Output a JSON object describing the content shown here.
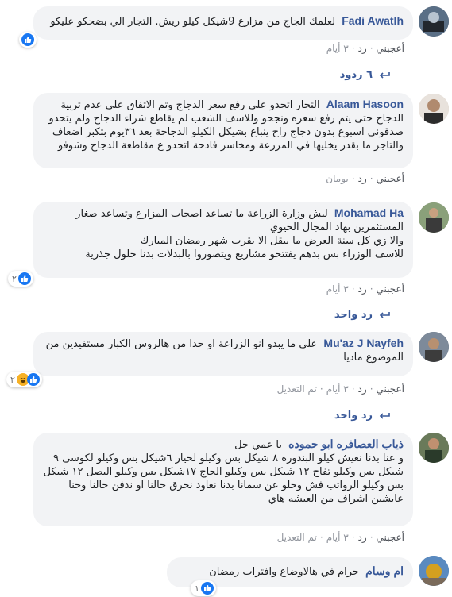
{
  "colors": {
    "author": "#385898",
    "bubble": "#f2f3f5",
    "like": "#1877f2",
    "haha": "#f7b125",
    "meta": "#90949c"
  },
  "comments": [
    {
      "author": "Fadi Awatlh",
      "text": "لعلمك الجاج من مزارع 9شيكل كيلو ريش. التجار الي بضحكو عليكو",
      "like_label": "أعجبني",
      "reply_label": "رد",
      "time": "٣ أيام",
      "reaction_icon": "like-icon"
    },
    {
      "author": "Alaam Hasoon",
      "text": "التجار اتحدو على رفع سعر الدجاج وتم الاتفاق على عدم تربية الدجاج حتى يتم رفع سعره ونجحو وللاسف الشعب لم يقاطع شراء الدجاج ولم يتحدو صدقوني اسبوع بدون دجاج راح ينباع بشيكل الكيلو الدجاجة بعد ٣٦يوم بتكبر اضعاف والتاجر ما بقدر يخليها في المزرعة ومخاسر فادحة اتحدو ع مقاطعة الدجاج وشوفو",
      "like_label": "أعجبني",
      "reply_label": "رد",
      "time": "يومان"
    },
    {
      "author": "Mohamad Ha",
      "text_lines": [
        "ليش وزارة الزراعة ما تساعد اصحاب المزارع وتساعد صغار المستثمرين بهاد المجال الحيوي",
        "والا زي كل سنة العرض ما بيقل الا بقرب شهر رمضان المبارك",
        "للاسف الوزراء بس بدهم يفتتحو مشاريع ويتصوروا بالبدلات بدنا حلول جذرية"
      ],
      "like_label": "أعجبني",
      "reply_label": "رد",
      "time": "٣ أيام",
      "reaction_count": "٢"
    },
    {
      "author": "Mu'az J Nayfeh",
      "text": "على ما يبدو انو الزراعة او حدا من هالروس الكبار مستفيدين من الموضوع ماديا",
      "like_label": "أعجبني",
      "reply_label": "رد",
      "time": "٣ أيام",
      "edited_label": "تم التعديل",
      "reaction_count": "٢"
    },
    {
      "author": "ذياب العصافره ابو حموده",
      "text_lines": [
        "يا عمي حل",
        "و عنا بدنا نعيش كيلو البندوره ٨ شيكل بس وكيلو لخيار ٦شيكل بس وكيلو لكوسى ٩ شيكل بس وكيلو تفاح ١٢ شيكل بس وكيلو الجاج ١٧شيكل بس وكيلو البصل ١٢ شيكل بس وكيلو الرواتب فش وحلو عن سمانا بدنا نعاود نحرق حالنا او ندفن حالنا وحنا عايشين اشراف من العيشه هاي"
      ],
      "like_label": "أعجبني",
      "reply_label": "رد",
      "time": "٣ أيام",
      "edited_label": "تم التعديل"
    },
    {
      "author": "ام وسام",
      "text": "حرام في هالاوضاع وافتراب رمضان",
      "reaction_count": "١"
    }
  ],
  "replies_toggles": [
    {
      "label": "٦ ردود"
    },
    {
      "label": "رد واحد"
    },
    {
      "label": "رد واحد"
    }
  ]
}
